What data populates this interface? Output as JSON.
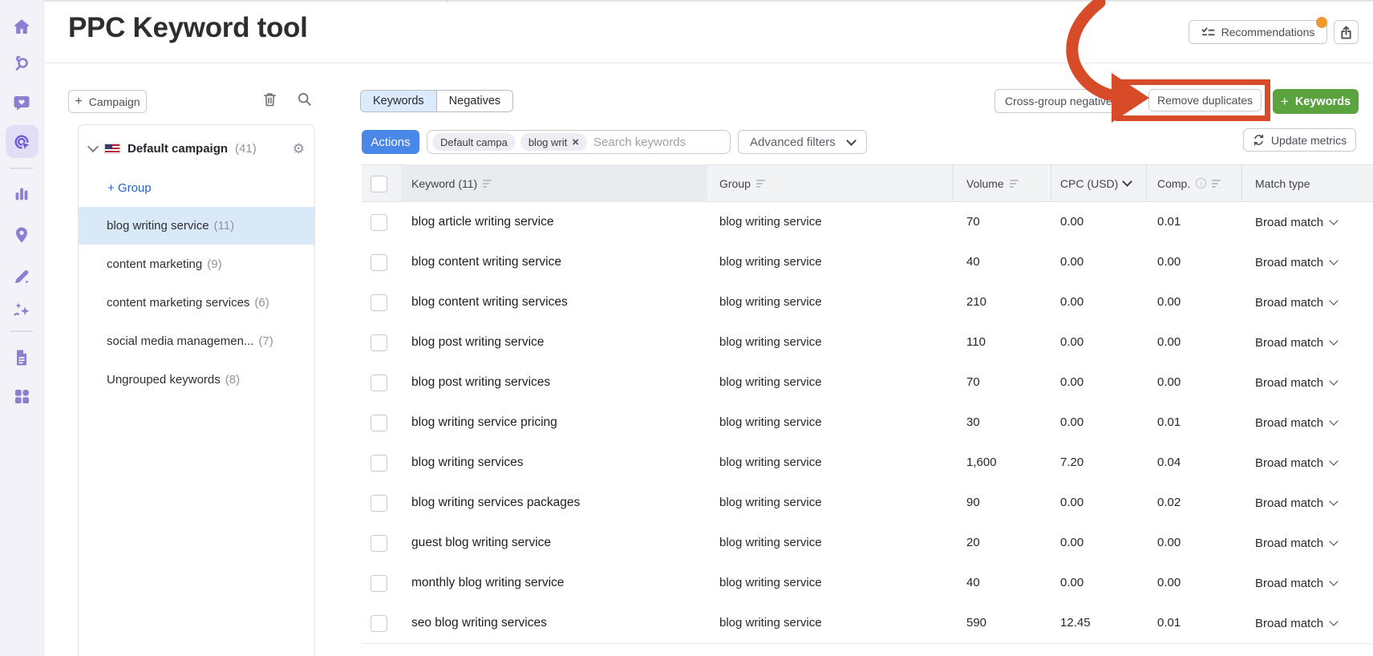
{
  "app": {
    "title": "PPC Keyword tool"
  },
  "header": {
    "recommendations_label": "Recommendations"
  },
  "sidebar": {
    "icons": [
      "home",
      "keyword-research",
      "social-media",
      "ppc-keyword-tool",
      "analytics",
      "local-marketing",
      "content-editor",
      "ai-assistant",
      "reports",
      "apps"
    ],
    "active_icon": "ppc-keyword-tool"
  },
  "top_toolbar": {
    "campaign_button_label": "Campaign",
    "tab_keywords": "Keywords",
    "tab_negatives": "Negatives",
    "cross_group_label": "Cross-group negatives",
    "remove_duplicates_label": "Remove duplicates",
    "add_keywords_label": "Keywords"
  },
  "filter_toolbar": {
    "actions_label": "Actions",
    "chips": [
      {
        "label": "Default campa",
        "closable": false
      },
      {
        "label": "blog writ",
        "closable": true
      }
    ],
    "search_placeholder": "Search keywords",
    "advanced_filters_label": "Advanced filters",
    "update_metrics_label": "Update metrics"
  },
  "campaign_panel": {
    "campaign_name": "Default campaign",
    "campaign_count": "(41)",
    "add_group_label": "+ Group",
    "groups": [
      {
        "name": "blog writing service",
        "count": "(11)",
        "selected": true
      },
      {
        "name": "content marketing",
        "count": "(9)",
        "selected": false
      },
      {
        "name": "content marketing services",
        "count": "(6)",
        "selected": false
      },
      {
        "name": "social media managemen...",
        "count": "(7)",
        "selected": false
      },
      {
        "name": "Ungrouped keywords",
        "count": "(8)",
        "selected": false
      }
    ]
  },
  "table": {
    "headers": {
      "keyword": "Keyword (11)",
      "group": "Group",
      "volume": "Volume",
      "cpc": "CPC (USD)",
      "comp": "Comp.",
      "match_type": "Match type"
    },
    "rows": [
      {
        "keyword": "blog article writing service",
        "group": "blog writing service",
        "volume": "70",
        "cpc": "0.00",
        "comp": "0.01",
        "match_type": "Broad match"
      },
      {
        "keyword": "blog content writing service",
        "group": "blog writing service",
        "volume": "40",
        "cpc": "0.00",
        "comp": "0.00",
        "match_type": "Broad match"
      },
      {
        "keyword": "blog content writing services",
        "group": "blog writing service",
        "volume": "210",
        "cpc": "0.00",
        "comp": "0.00",
        "match_type": "Broad match"
      },
      {
        "keyword": "blog post writing service",
        "group": "blog writing service",
        "volume": "110",
        "cpc": "0.00",
        "comp": "0.00",
        "match_type": "Broad match"
      },
      {
        "keyword": "blog post writing services",
        "group": "blog writing service",
        "volume": "70",
        "cpc": "0.00",
        "comp": "0.00",
        "match_type": "Broad match"
      },
      {
        "keyword": "blog writing service pricing",
        "group": "blog writing service",
        "volume": "30",
        "cpc": "0.00",
        "comp": "0.01",
        "match_type": "Broad match"
      },
      {
        "keyword": "blog writing services",
        "group": "blog writing service",
        "volume": "1,600",
        "cpc": "7.20",
        "comp": "0.04",
        "match_type": "Broad match"
      },
      {
        "keyword": "blog writing services packages",
        "group": "blog writing service",
        "volume": "90",
        "cpc": "0.00",
        "comp": "0.02",
        "match_type": "Broad match"
      },
      {
        "keyword": "guest blog writing service",
        "group": "blog writing service",
        "volume": "20",
        "cpc": "0.00",
        "comp": "0.00",
        "match_type": "Broad match"
      },
      {
        "keyword": "monthly blog writing service",
        "group": "blog writing service",
        "volume": "40",
        "cpc": "0.00",
        "comp": "0.00",
        "match_type": "Broad match"
      },
      {
        "keyword": "seo blog writing services",
        "group": "blog writing service",
        "volume": "590",
        "cpc": "12.45",
        "comp": "0.01",
        "match_type": "Broad match"
      }
    ]
  },
  "colors": {
    "annotation_red": "#d84b28",
    "accent_blue": "#4b87e8",
    "green_button": "#5aa33f",
    "badge_orange": "#ef9a2e",
    "sidebar_purple": "#8c7fd2",
    "selected_group_bg": "#d9e9f8",
    "selected_tab_bg": "#dcebfb"
  }
}
